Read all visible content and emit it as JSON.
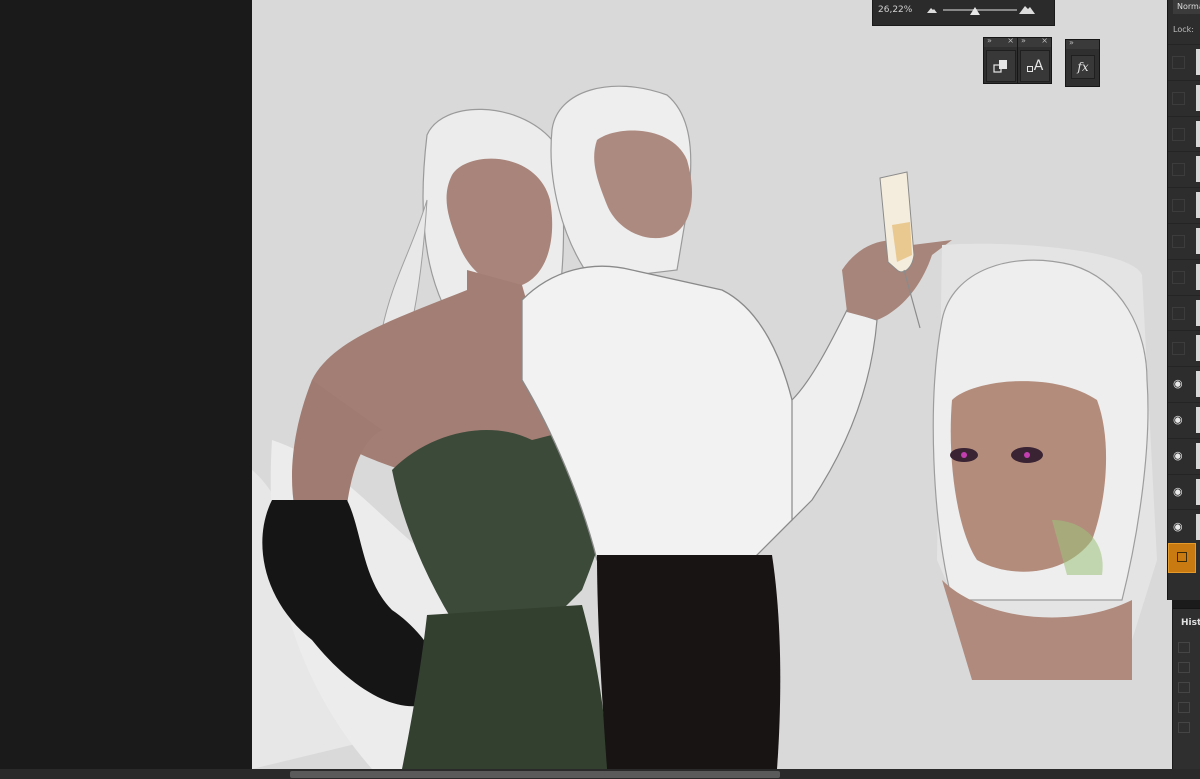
{
  "navigator": {
    "zoom_value": "26,22%",
    "zoom_level": 26.22,
    "zoom_out_icon": "mountain-small-icon",
    "zoom_in_icon": "mountain-large-icon"
  },
  "floating_panels": {
    "panel_controls": {
      "collapse": "»",
      "close": "×"
    },
    "char_panel_glyph": "A",
    "fx_panel_glyph": "fx"
  },
  "layers_panel": {
    "blend_mode": "Normal",
    "lock_label": "Lock:",
    "rows_visible": [
      false,
      false,
      false,
      false,
      false,
      false,
      false,
      false,
      false,
      true,
      true,
      true,
      true,
      true,
      false
    ],
    "active_layer_color": "#c97a10"
  },
  "history_panel": {
    "title": "History"
  },
  "colors": {
    "canvas_bg": "#d9d9d9",
    "workspace_bg": "#1a1a1a",
    "panel_bg": "#2d2d2d",
    "accent": "#c97a10"
  }
}
